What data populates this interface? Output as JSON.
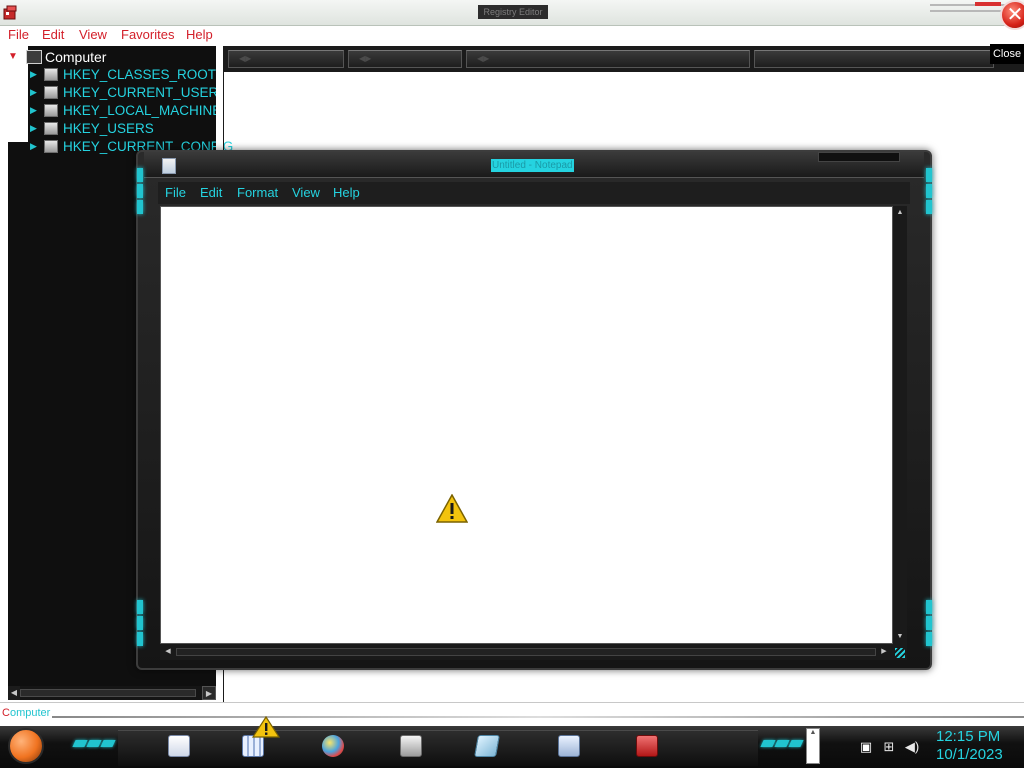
{
  "registry_editor": {
    "title": "Registry Editor",
    "close_symbol": "✕",
    "close_hint": "Close",
    "menu": [
      "File",
      "Edit",
      "View",
      "Favorites",
      "Help"
    ],
    "tree": {
      "root": "Computer",
      "keys": [
        "HKEY_CLASSES_ROOT",
        "HKEY_CURRENT_USER",
        "HKEY_LOCAL_MACHINE",
        "HKEY_USERS",
        "HKEY_CURRENT_CONFIG"
      ]
    },
    "status": {
      "first": "C",
      "rest": "omputer"
    },
    "icons": {
      "app": "registry-icon",
      "computer": "computer-icon",
      "key": "folder-icon",
      "expand": "triangle-right-icon",
      "collapse": "chevron-down-icon"
    }
  },
  "notepad": {
    "title": "Untitled - Notepad",
    "menu": [
      "File",
      "Edit",
      "Format",
      "View",
      "Help"
    ],
    "text": ""
  },
  "taskbar": {
    "clock_time": "12:15 PM",
    "clock_date": "10/1/2023",
    "apps": [
      "wordpad-icon",
      "calculator-icon",
      "paint-icon",
      "printer-icon",
      "notepad-icon",
      "performance-monitor-icon",
      "toolbox-icon"
    ],
    "tray": [
      "network-error-icon",
      "network-icon",
      "volume-icon"
    ]
  },
  "colors": {
    "accent_cyan": "#25d3e0",
    "menu_red": "#d3202a",
    "frame_dark": "#1a1a1a"
  }
}
